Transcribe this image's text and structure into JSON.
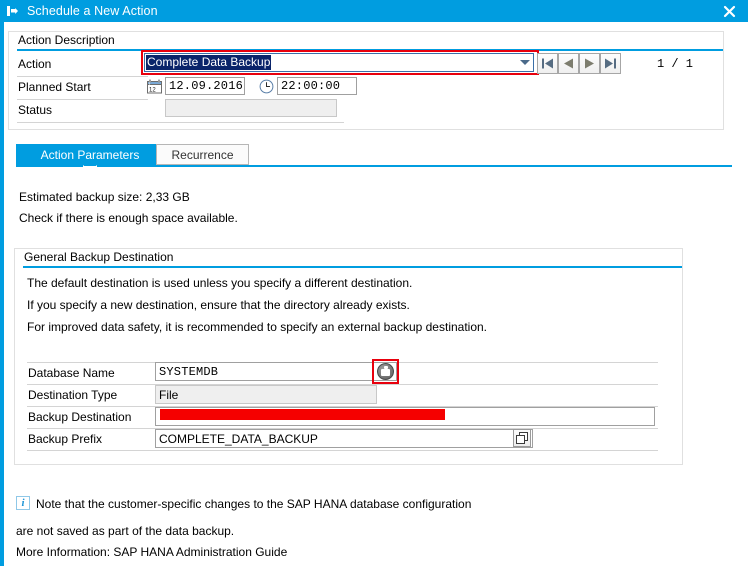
{
  "window": {
    "title": "Schedule a New Action",
    "title_icon": "schedule-action-icon",
    "close_icon": "close-icon",
    "accent_color": "#009de0"
  },
  "action_description": {
    "group_title": "Action Description",
    "fields": {
      "action_label": "Action",
      "action_value": "Complete Data Backup",
      "planned_start_label": "Planned Start",
      "planned_start_date": "12.09.2016",
      "planned_start_time": "22:00:00",
      "status_label": "Status",
      "status_value": ""
    },
    "icons": {
      "calendar": "calendar-icon",
      "clock": "clock-icon",
      "dropdown": "chevron-down-icon"
    },
    "navigation": {
      "first": "first-record-icon",
      "previous": "previous-record-icon",
      "next": "next-record-icon",
      "last": "last-record-icon",
      "page_indicator": "1 / 1"
    }
  },
  "tabs": [
    {
      "label": "Action Parameters",
      "active": true
    },
    {
      "label": "Recurrence",
      "active": false
    }
  ],
  "action_parameters": {
    "estimate_line": "Estimated backup size: 2,33 GB",
    "check_line": "Check if there is enough space available.",
    "general_backup_destination": {
      "group_title": "General Backup Destination",
      "hint_lines": [
        "The default destination is used unless you specify a different destination.",
        "If you specify a new destination, ensure that the directory already exists.",
        "For improved data safety, it is recommended to specify an external backup destination."
      ],
      "rows": [
        {
          "label": "Database Name",
          "value": "SYSTEMDB",
          "readonly": false
        },
        {
          "label": "Destination Type",
          "value": "File",
          "readonly": true
        },
        {
          "label": "Backup Destination",
          "value": "",
          "readonly": false,
          "redacted": true
        },
        {
          "label": "Backup Prefix",
          "value": "COMPLETE_DATA_BACKUP",
          "readonly": false
        }
      ],
      "database_browse_icon": "database-browse-icon",
      "backup_prefix_copy_icon": "copy-icon"
    },
    "note": {
      "icon": "info-icon",
      "line1": "Note that the customer-specific changes to the SAP HANA database configuration",
      "line2": "are not saved as part of the data backup.",
      "line3": "More Information: SAP HANA Administration Guide"
    }
  }
}
